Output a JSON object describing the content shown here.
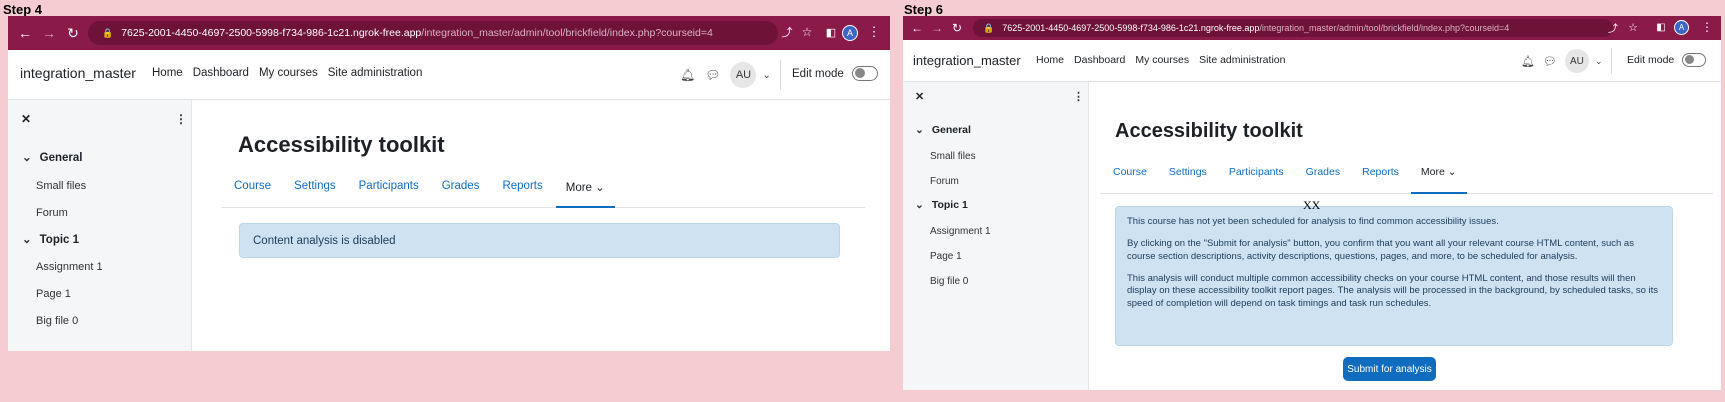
{
  "steps": [
    {
      "label": "Step 4",
      "browser": {
        "url_host": "7625-2001-4450-4697-2500-5998-f734-986-1c21.ngrok-free.app",
        "url_path": "/integration_master/admin/tool/brickfield/index.php?courseid=4",
        "avatar": "A"
      },
      "site": {
        "brand": "integration_master",
        "nav": [
          "Home",
          "Dashboard",
          "My courses",
          "Site administration"
        ],
        "user_initials": "AU",
        "edit_mode_label": "Edit mode"
      },
      "drawer": {
        "close": "✕",
        "more": "⋮",
        "items": [
          {
            "label": "General",
            "section": true
          },
          {
            "label": "Small files",
            "section": false
          },
          {
            "label": "Forum",
            "section": false
          },
          {
            "label": "Topic 1",
            "section": true
          },
          {
            "label": "Assignment 1",
            "section": false
          },
          {
            "label": "Page 1",
            "section": false
          },
          {
            "label": "Big file 0",
            "section": false
          }
        ]
      },
      "page_title": "Accessibility toolkit",
      "tabs": [
        "Course",
        "Settings",
        "Participants",
        "Grades",
        "Reports",
        "More ⌄"
      ],
      "active_tab": 5,
      "alert": [
        "Content analysis is disabled"
      ]
    },
    {
      "label": "Step 6",
      "browser": {
        "url_host": "7625-2001-4450-4697-2500-5998-f734-986-1c21.ngrok-free.app",
        "url_path": "/integration_master/admin/tool/brickfield/index.php?courseid=4",
        "avatar": "A"
      },
      "site": {
        "brand": "integration_master",
        "nav": [
          "Home",
          "Dashboard",
          "My courses",
          "Site administration"
        ],
        "user_initials": "AU",
        "edit_mode_label": "Edit mode"
      },
      "drawer": {
        "close": "✕",
        "more": "⋮",
        "items": [
          {
            "label": "General",
            "section": true
          },
          {
            "label": "Small files",
            "section": false
          },
          {
            "label": "Forum",
            "section": false
          },
          {
            "label": "Topic 1",
            "section": true
          },
          {
            "label": "Assignment 1",
            "section": false
          },
          {
            "label": "Page 1",
            "section": false
          },
          {
            "label": "Big file 0",
            "section": false
          }
        ]
      },
      "page_title": "Accessibility toolkit",
      "tabs": [
        "Course",
        "Settings",
        "Participants",
        "Grades",
        "Reports",
        "More ⌄"
      ],
      "active_tab": 5,
      "alert": [
        "This course has not yet been scheduled for analysis to find common accessibility issues.",
        "By clicking on the \"Submit for analysis\" button, you confirm that you want all your relevant course HTML content, such as course section descriptions, activity descriptions, questions, pages, and more, to be scheduled for analysis.",
        "This analysis will conduct multiple common accessibility checks on your course HTML content, and those results will then display on these accessibility toolkit report pages. The analysis will be processed in the background, by scheduled tasks, so its speed of completion will depend on task timings and task run schedules."
      ],
      "submit_label": "Submit for analysis",
      "marker": "XX"
    }
  ],
  "colors": {
    "browser_bar": "#8a1a47",
    "link": "#0f6cbf",
    "alert_bg": "#cfe2f2",
    "backdrop": "#f6ccd3"
  }
}
